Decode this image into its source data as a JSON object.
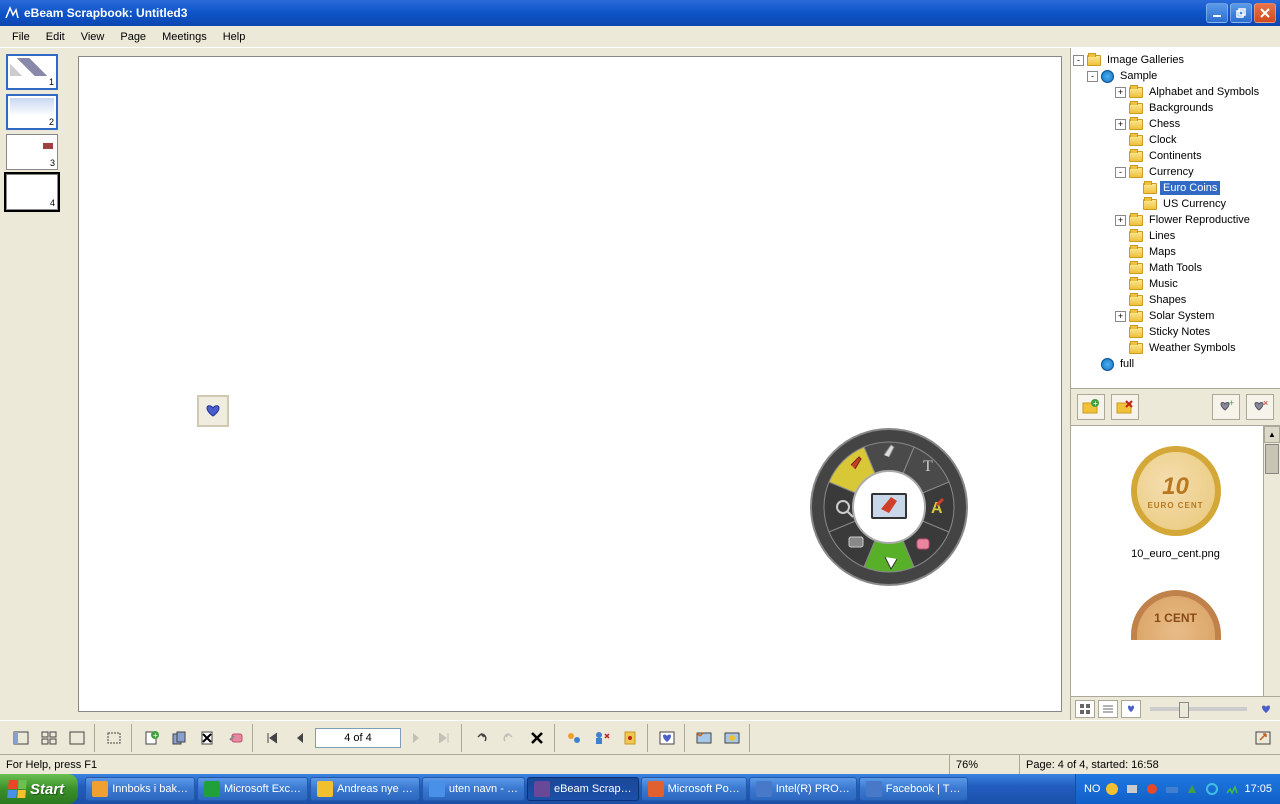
{
  "title": "eBeam Scrapbook: Untitled3",
  "menubar": [
    "File",
    "Edit",
    "View",
    "Page",
    "Meetings",
    "Help"
  ],
  "thumbnails": [
    {
      "num": "1",
      "active": true
    },
    {
      "num": "2",
      "active": false
    },
    {
      "num": "3",
      "active": false
    },
    {
      "num": "4",
      "active": false,
      "selected": true
    }
  ],
  "tree": {
    "root": "Image Galleries",
    "sample": "Sample",
    "items": [
      {
        "label": "Alphabet and Symbols",
        "exp": "+",
        "indent": 2
      },
      {
        "label": "Backgrounds",
        "exp": "",
        "indent": 2
      },
      {
        "label": "Chess",
        "exp": "+",
        "indent": 2
      },
      {
        "label": "Clock",
        "exp": "",
        "indent": 2
      },
      {
        "label": "Continents",
        "exp": "",
        "indent": 2
      },
      {
        "label": "Currency",
        "exp": "-",
        "indent": 2
      },
      {
        "label": "Euro Coins",
        "exp": "",
        "indent": 3,
        "sel": true
      },
      {
        "label": "US Currency",
        "exp": "",
        "indent": 3
      },
      {
        "label": "Flower Reproductive",
        "exp": "+",
        "indent": 2
      },
      {
        "label": "Lines",
        "exp": "",
        "indent": 2
      },
      {
        "label": "Maps",
        "exp": "",
        "indent": 2
      },
      {
        "label": "Math Tools",
        "exp": "",
        "indent": 2
      },
      {
        "label": "Music",
        "exp": "",
        "indent": 2
      },
      {
        "label": "Shapes",
        "exp": "",
        "indent": 2
      },
      {
        "label": "Solar System",
        "exp": "+",
        "indent": 2
      },
      {
        "label": "Sticky Notes",
        "exp": "",
        "indent": 2
      },
      {
        "label": "Weather Symbols",
        "exp": "",
        "indent": 2
      }
    ],
    "full": "full"
  },
  "preview": {
    "coin10_num": "10",
    "coin10_txt": "EURO CENT",
    "coin10_file": "10_euro_cent.png",
    "coin1_txt": "1 CENT"
  },
  "page_input": "4 of 4",
  "status": {
    "help": "For Help, press F1",
    "zoom": "76%",
    "page": "Page: 4 of 4, started: 16:58"
  },
  "taskbar": {
    "start": "Start",
    "items": [
      {
        "label": "Innboks i bak…",
        "color": "#f0a030"
      },
      {
        "label": "Microsoft Exc…",
        "color": "#20a038"
      },
      {
        "label": "Andreas nye …",
        "color": "#f0c030"
      },
      {
        "label": "uten navn - …",
        "color": "#4890e8"
      },
      {
        "label": "eBeam Scrap…",
        "color": "#6a4898",
        "active": true
      },
      {
        "label": "Microsoft Po…",
        "color": "#e06030"
      },
      {
        "label": "Intel(R) PRO…",
        "color": "#4878c8"
      },
      {
        "label": "Facebook | T…",
        "color": "#4878c8"
      }
    ],
    "lang": "NO",
    "clock": "17:05"
  }
}
